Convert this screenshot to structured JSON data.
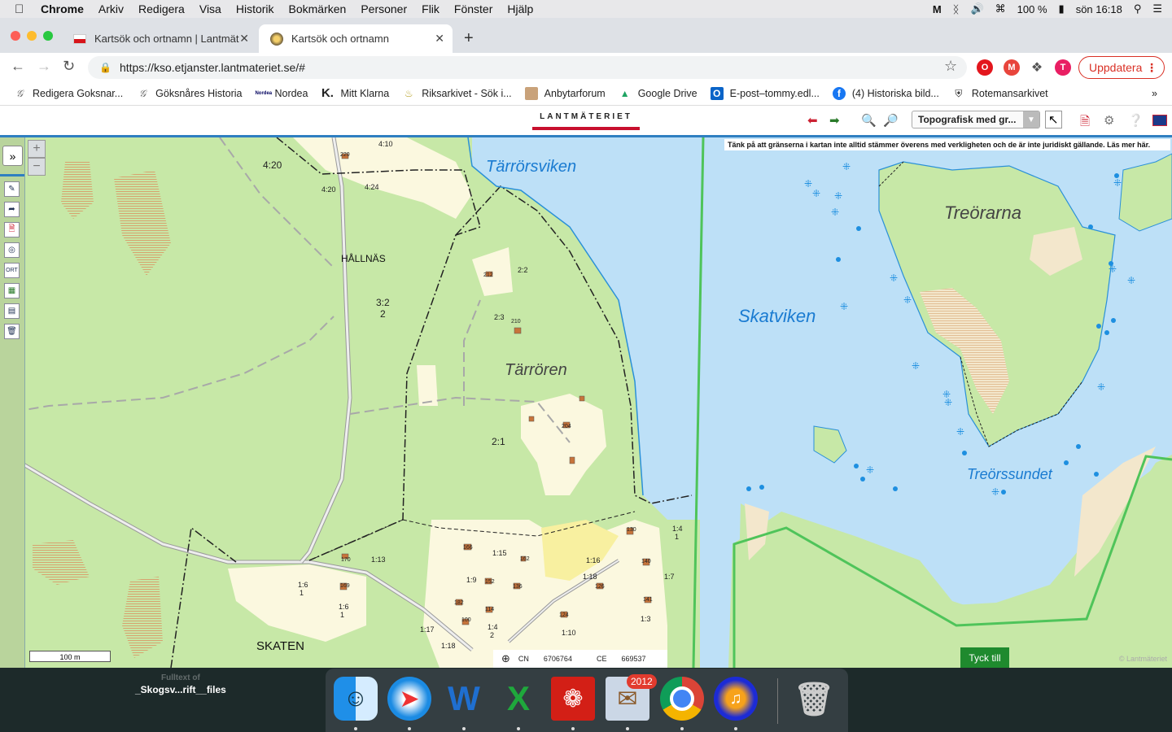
{
  "menubar": {
    "app": "Chrome",
    "items": [
      "Arkiv",
      "Redigera",
      "Visa",
      "Historik",
      "Bokmärken",
      "Personer",
      "Flik",
      "Fönster",
      "Hjälp"
    ],
    "battery": "100 %",
    "clock": "sön 16:18"
  },
  "tabs": [
    {
      "label": "Kartsök och ortnamn | Lantmät",
      "active": false
    },
    {
      "label": "Kartsök och ortnamn",
      "active": true
    }
  ],
  "address": {
    "url": "https://kso.etjanster.lantmateriet.se/#"
  },
  "update_label": "Uppdatera",
  "profile_initial": "T",
  "bookmarks": [
    {
      "label": "Redigera Goksnar...",
      "icon": "g-script-icon"
    },
    {
      "label": "Göksnåres Historia",
      "icon": "g-script-icon"
    },
    {
      "label": "Nordea",
      "icon": "nordea-icon"
    },
    {
      "label": "Mitt Klarna",
      "icon": "klarna-icon"
    },
    {
      "label": "Riksarkivet - Sök i...",
      "icon": "riksarkivet-icon"
    },
    {
      "label": "Anbytarforum",
      "icon": "avatar-icon"
    },
    {
      "label": "Google Drive",
      "icon": "drive-icon"
    },
    {
      "label": "E-post–tommy.edl...",
      "icon": "outlook-icon"
    },
    {
      "label": "(4) Historiska bild...",
      "icon": "facebook-icon"
    },
    {
      "label": "Rotemansarkivet",
      "icon": "shield-icon"
    }
  ],
  "site": {
    "logo": "LANTMÄTERIET",
    "map_type": "Topografisk med gr..."
  },
  "map": {
    "disclaimer": "Tänk på att gränserna i kartan inte alltid stämmer överens med verkligheten och de är inte juridiskt gällande. Läs mer här.",
    "labels": {
      "tarrorsviken": "Tärrörsviken",
      "tarroren": "Tärrören",
      "skatviken": "Skatviken",
      "treorarna": "Treörarna",
      "treorssundet": "Treörssundet",
      "hallnas": "HÅLLNÄS",
      "skaten": "SKATEN",
      "p420": "4:20",
      "p410": "4:10",
      "p420b": "4:20",
      "p424": "4:24",
      "p32": "3:2",
      "p2": "2",
      "p22": "2:2",
      "p23": "2:3",
      "p21": "2:1",
      "p113": "1:13",
      "p115": "1:15",
      "p19": "1:9",
      "p116": "1:16",
      "p118": "1:18",
      "p117": "1:17",
      "p118b": "1:18",
      "p17": "1:7",
      "p14": "1:4",
      "p16": "1:6",
      "p16b": "1:6",
      "p110": "1:10",
      "p14b": "1:4",
      "p13": "1:3",
      "p1a": "1",
      "p1b": "1",
      "p2b": "2",
      "p1c": "1",
      "h212": "212",
      "h210": "210",
      "h204": "204",
      "h170": "170",
      "h169": "169",
      "h166": "166",
      "h162": "162",
      "h152": "152",
      "h136": "136",
      "h182": "182",
      "h114": "114",
      "h100": "100",
      "h130": "130",
      "h140": "140",
      "h124": "124",
      "h141": "141",
      "h126": "126",
      "h220": "220"
    },
    "scale": "100 m",
    "coords": {
      "cn_label": "CN",
      "cn": "6706764",
      "ce_label": "CE",
      "ce": "669537"
    },
    "feedback": "Tyck till",
    "credit": "© Lantmäteriet"
  },
  "desktop": {
    "label_line1": "Fulltext of",
    "label_line2": "_Skogsv...rift__files"
  },
  "dock": {
    "mail_badge": "2012",
    "apps": [
      "finder",
      "safari",
      "word",
      "excel",
      "acrobat",
      "mail",
      "chrome",
      "audacity",
      "trash"
    ]
  }
}
